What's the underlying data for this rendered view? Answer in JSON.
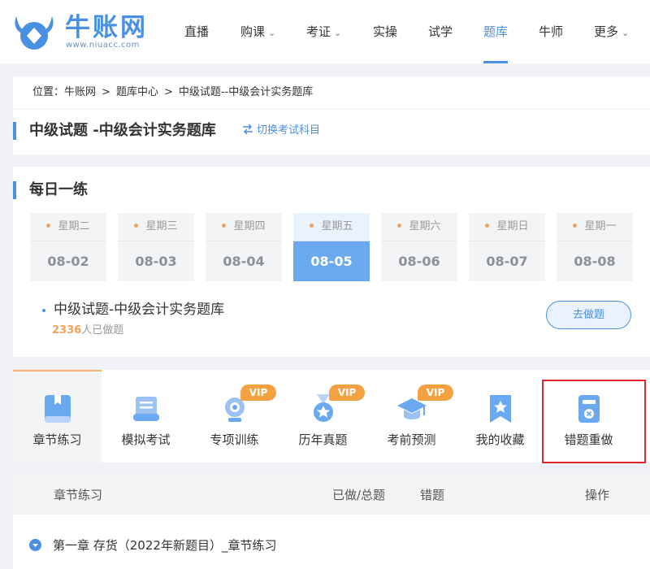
{
  "brand": {
    "name": "牛账网",
    "url": "www.niuacc.com",
    "accent": "#4a90e2"
  },
  "nav": {
    "items": [
      {
        "label": "直播"
      },
      {
        "label": "购课",
        "has_dropdown": true
      },
      {
        "label": "考证",
        "has_dropdown": true
      },
      {
        "label": "实操"
      },
      {
        "label": "试学"
      },
      {
        "label": "题库",
        "active": true
      },
      {
        "label": "牛师"
      },
      {
        "label": "更多",
        "has_dropdown": true
      }
    ]
  },
  "breadcrumb": {
    "prefix": "位置：",
    "items": [
      "牛账网",
      "题库中心",
      "中级试题--中级会计实务题库"
    ],
    "separator": ">"
  },
  "page": {
    "title": "中级试题 -中级会计实务题库",
    "switch_label": "切换考试科目"
  },
  "daily": {
    "title": "每日一练",
    "days": [
      {
        "week": "星期二",
        "date": "08-02"
      },
      {
        "week": "星期三",
        "date": "08-03"
      },
      {
        "week": "星期四",
        "date": "08-04"
      },
      {
        "week": "星期五",
        "date": "08-05",
        "active": true
      },
      {
        "week": "星期六",
        "date": "08-06"
      },
      {
        "week": "星期日",
        "date": "08-07"
      },
      {
        "week": "星期一",
        "date": "08-08"
      }
    ],
    "exercise": {
      "title": "中级试题-中级会计实务题库",
      "count": "2336",
      "count_suffix": "人已做题",
      "button": "去做题"
    }
  },
  "tabs": [
    {
      "label": "章节练习",
      "icon": "book-icon",
      "active": true
    },
    {
      "label": "模拟考试",
      "icon": "scroll-icon"
    },
    {
      "label": "专项训练",
      "icon": "target-trophy-icon",
      "vip": "VIP"
    },
    {
      "label": "历年真题",
      "icon": "medal-icon",
      "vip": "VIP"
    },
    {
      "label": "考前预测",
      "icon": "graduation-cap-icon",
      "vip": "VIP"
    },
    {
      "label": "我的收藏",
      "icon": "bookmark-star-icon"
    },
    {
      "label": "错题重做",
      "icon": "wrong-answer-icon",
      "highlighted": true
    }
  ],
  "table": {
    "headers": {
      "chapter": "章节练习",
      "progress": "已做/总题",
      "wrong": "错题",
      "action": "操作"
    },
    "rows": [
      {
        "title": "第一章 存货（2022年新题目）_章节练习"
      }
    ]
  },
  "colors": {
    "accent": "#4a90e2",
    "vip": "#f4a142",
    "highlight_border": "#e0262c",
    "active_day": "#6aa8f0"
  }
}
